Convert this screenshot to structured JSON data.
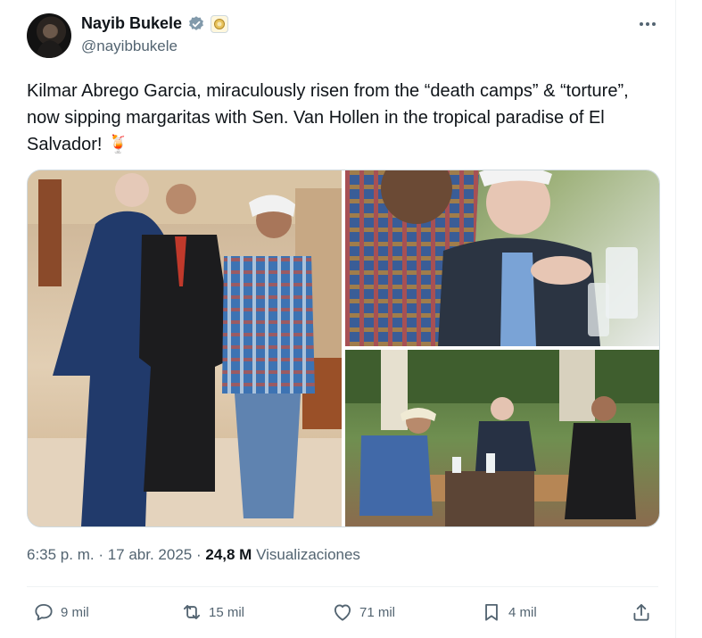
{
  "author": {
    "name": "Nayib Bukele",
    "handle": "@nayibbukele"
  },
  "tweet": {
    "text": "Kilmar Abrego Garcia, miraculously risen from the “death camps” & “torture”, now sipping margaritas with Sen. Van Hollen in the tropical paradise of El Salvador! 🍹"
  },
  "meta": {
    "time": "6:35 p. m.",
    "sep1": " · ",
    "date": "17 abr. 2025",
    "sep2": " · ",
    "views": "24,8 M",
    "views_label": " Visualizaciones"
  },
  "actions": {
    "replies": "9 mil",
    "reposts": "15 mil",
    "likes": "71 mil",
    "bookmarks": "4 mil"
  },
  "colors": {
    "text": "#0f1419",
    "secondary": "#536471",
    "verified": "#829aab",
    "divider": "#eff3f4"
  },
  "icons": [
    "verified-badge-icon",
    "affiliate-badge-icon",
    "more-icon",
    "reply-icon",
    "repost-icon",
    "like-icon",
    "bookmark-icon",
    "share-icon"
  ]
}
